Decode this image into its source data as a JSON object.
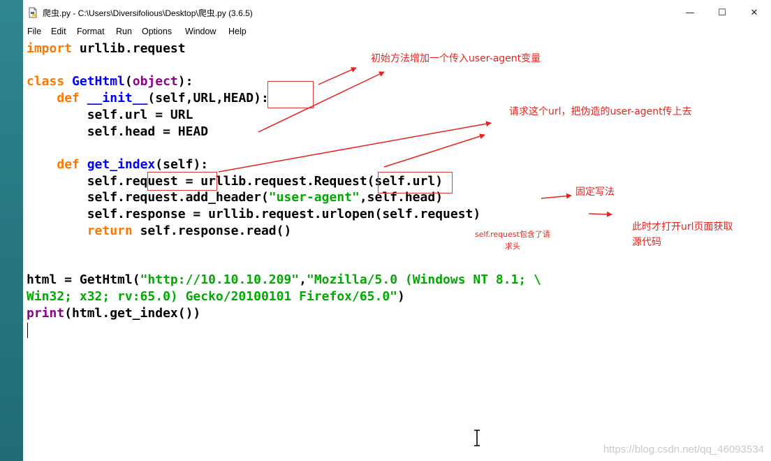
{
  "window": {
    "title": "爬虫.py - C:\\Users\\Diversifolious\\Desktop\\爬虫.py (3.6.5)",
    "minimize_glyph": "—",
    "maximize_glyph": "☐",
    "close_glyph": "✕"
  },
  "menu": [
    "File",
    "Edit",
    "Format",
    "Run",
    "Options",
    "Window",
    "Help"
  ],
  "code": {
    "l1": [
      "import",
      " urllib.request"
    ],
    "l3": [
      "class",
      " ",
      "GetHtml",
      "(",
      "object",
      "):"
    ],
    "l4": [
      "    ",
      "def",
      " ",
      "__init__",
      "(self,URL,HEAD):"
    ],
    "l5": [
      "        self.url = URL"
    ],
    "l6": [
      "        self.head = HEAD"
    ],
    "l8": [
      "    ",
      "def",
      " ",
      "get_index",
      "(self):"
    ],
    "l9": [
      "        self.request = urllib.request.Request(self.url)"
    ],
    "l10": [
      "        self.request.add_header(",
      "\"user-agent\"",
      ",self.head)"
    ],
    "l11": [
      "        self.response = urllib.request.urlopen(self.request)"
    ],
    "l12": [
      "        ",
      "return",
      " self.response.read()"
    ],
    "l15": [
      "html = GetHtml(",
      "\"http://10.10.10.209\"",
      ",",
      "\"Mozilla/5.0 (Windows NT 8.1; \\"
    ],
    "l16": [
      "Win32; x32; rv:65.0) Gecko/20100101 Firefox/65.0\"",
      ")"
    ],
    "l17": [
      "print",
      "(html.get_index())"
    ]
  },
  "annotations": {
    "a1": "初始方法增加一个传入user-agent变量",
    "a2": "请求这个url，把伪造的user-agent传上去",
    "a3": "固定写法",
    "a4": "此时才打开url页面获取",
    "a4b": "源代码",
    "a5": "self.request包含了请",
    "a5b": "求头"
  },
  "watermark": "https://blog.csdn.net/qq_46093534",
  "colors": {
    "keyword": "#ff7700",
    "builtin": "#900090",
    "definition": "#0000ff",
    "string": "#00aa00",
    "annotation": "#e8231f"
  }
}
